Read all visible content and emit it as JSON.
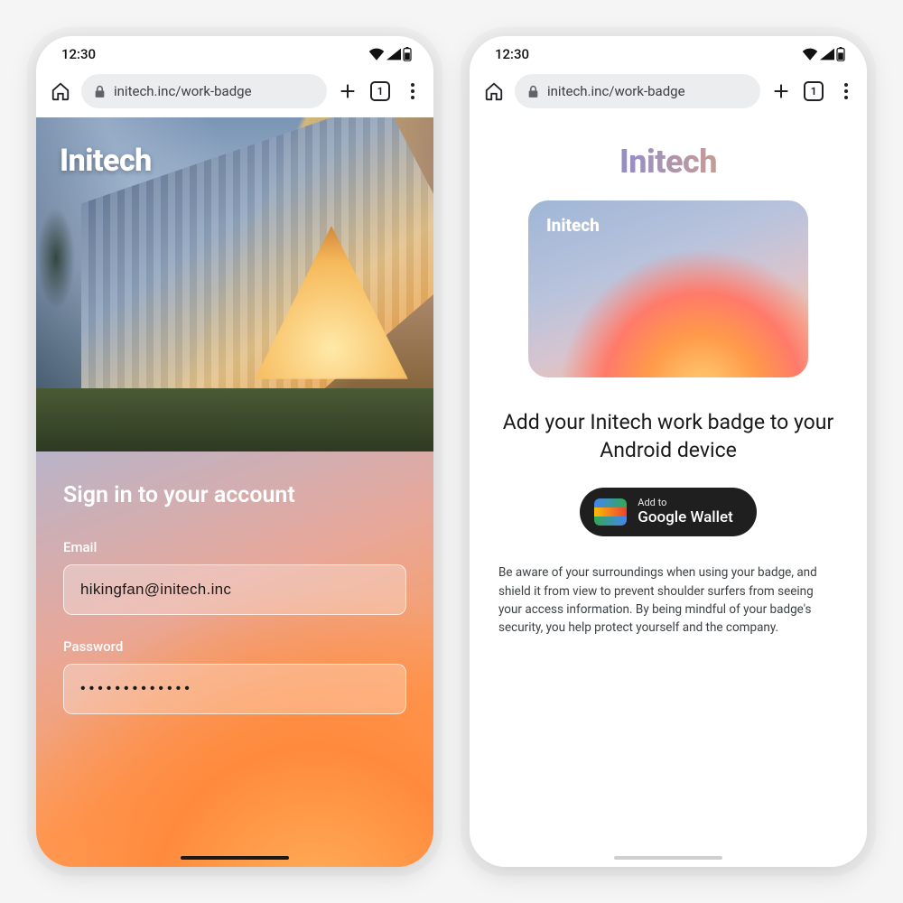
{
  "status": {
    "time": "12:30"
  },
  "browser": {
    "url": "initech.inc/work-badge",
    "tab_count": "1"
  },
  "left": {
    "brand": "Initech",
    "signin_title": "Sign in to your account",
    "email_label": "Email",
    "email_value": "hikingfan@initech.inc",
    "password_label": "Password",
    "password_value": "•••••••••••••"
  },
  "right": {
    "brand": "Initech",
    "card_brand": "Initech",
    "headline": "Add your Initech work badge to your Android device",
    "wallet_line1": "Add to",
    "wallet_line2": "Google Wallet",
    "disclaimer": "Be aware of your surroundings when using your badge, and shield it from view to prevent shoulder surfers from seeing your access information.  By being mindful of your badge's security, you help protect yourself and the company."
  }
}
